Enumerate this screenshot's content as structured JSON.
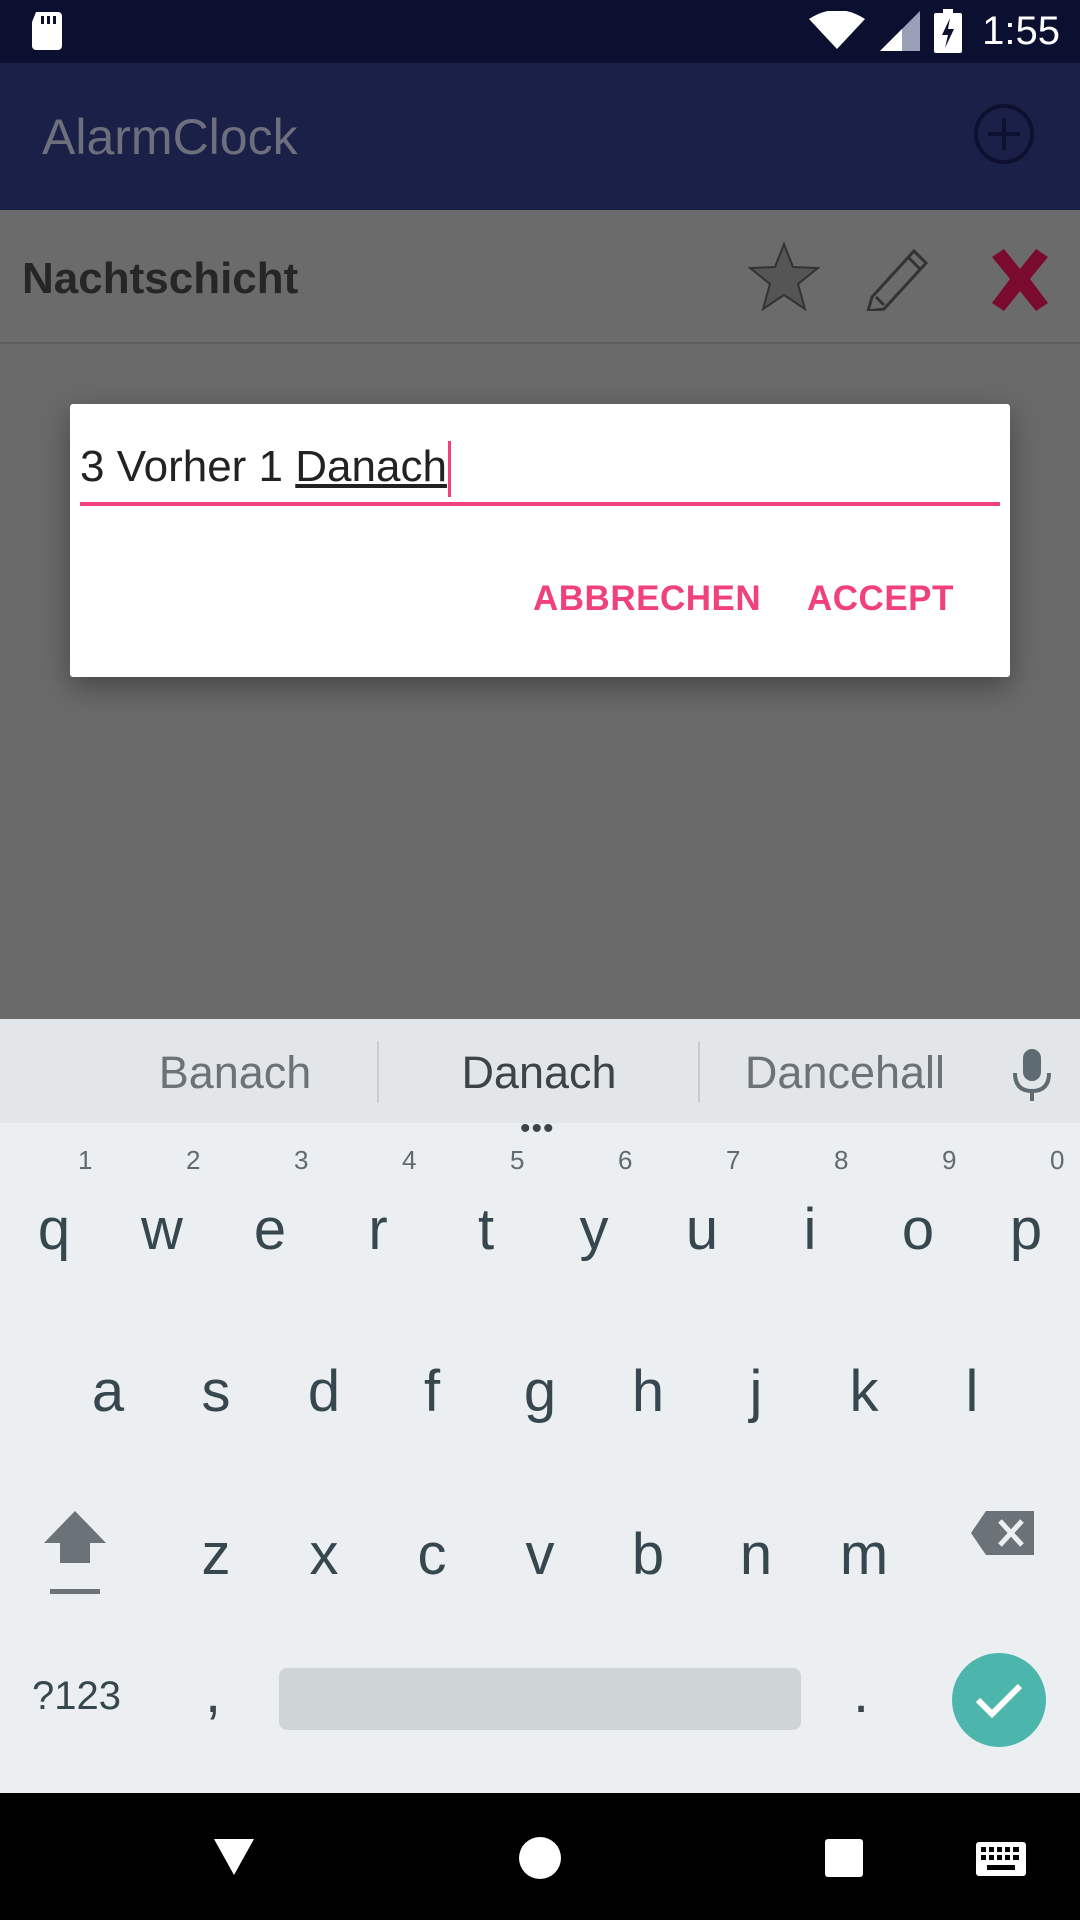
{
  "status_bar": {
    "time": "1:55",
    "icons": [
      "sd-card-icon",
      "wifi-icon",
      "signal-icon",
      "battery-charging-icon"
    ]
  },
  "app_bar": {
    "title": "AlarmClock",
    "add_icon": "plus-circle-icon"
  },
  "list": {
    "items": [
      {
        "title": "Nachtschicht",
        "icons": [
          "star-icon",
          "pencil-icon",
          "delete-x-icon"
        ]
      }
    ]
  },
  "dialog": {
    "input_value_prefix": "3 Vorher 1 ",
    "input_value_composing": "Danach",
    "cancel_label": "ABBRECHEN",
    "accept_label": "ACCEPT"
  },
  "keyboard": {
    "suggestions": [
      "Banach",
      "Danach",
      "Dancehall"
    ],
    "row1": [
      "q",
      "w",
      "e",
      "r",
      "t",
      "y",
      "u",
      "i",
      "o",
      "p"
    ],
    "row1_hints": [
      "1",
      "2",
      "3",
      "4",
      "5",
      "6",
      "7",
      "8",
      "9",
      "0"
    ],
    "row2": [
      "a",
      "s",
      "d",
      "f",
      "g",
      "h",
      "j",
      "k",
      "l"
    ],
    "row3": [
      "z",
      "x",
      "c",
      "v",
      "b",
      "n",
      "m"
    ],
    "symbols_label": "?123",
    "comma": ",",
    "period": "."
  },
  "colors": {
    "accent": "#f0407e",
    "appbar": "#1b2048",
    "statusbar": "#0c1030",
    "enter_key": "#4db6ac",
    "delete_icon": "#7a0a2e"
  }
}
